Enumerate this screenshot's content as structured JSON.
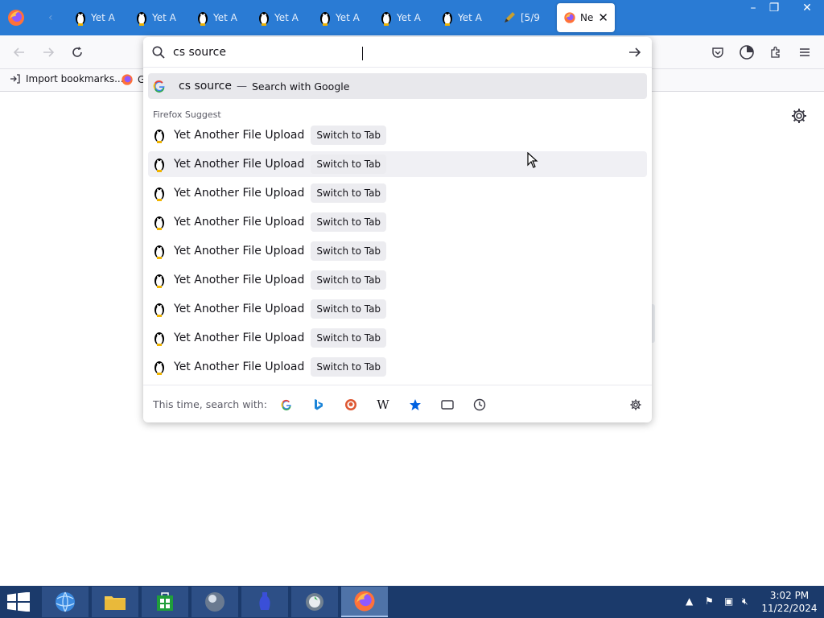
{
  "tabs": [
    {
      "label": "Yet A",
      "icon": "penguin-icon"
    },
    {
      "label": "Yet A",
      "icon": "penguin-icon"
    },
    {
      "label": "Yet A",
      "icon": "penguin-icon"
    },
    {
      "label": "Yet A",
      "icon": "penguin-icon"
    },
    {
      "label": "Yet A",
      "icon": "penguin-icon"
    },
    {
      "label": "Yet A",
      "icon": "penguin-icon"
    },
    {
      "label": "Yet A",
      "icon": "penguin-icon"
    },
    {
      "label": "[5/9",
      "icon": "pencil-icon"
    },
    {
      "label": "Ne",
      "icon": "firefox-icon"
    }
  ],
  "bookmarks": {
    "import_label": "Import bookmarks...",
    "getting_started_label": "G"
  },
  "urlbar": {
    "value": "cs source",
    "google_suggestion": {
      "query": "cs source",
      "separator": "—",
      "action": "Search with Google"
    },
    "section_label": "Firefox Suggest",
    "rows": [
      {
        "title": "Yet Another File Upload",
        "action": "Switch to Tab"
      },
      {
        "title": "Yet Another File Upload",
        "action": "Switch to Tab"
      },
      {
        "title": "Yet Another File Upload",
        "action": "Switch to Tab"
      },
      {
        "title": "Yet Another File Upload",
        "action": "Switch to Tab"
      },
      {
        "title": "Yet Another File Upload",
        "action": "Switch to Tab"
      },
      {
        "title": "Yet Another File Upload",
        "action": "Switch to Tab"
      },
      {
        "title": "Yet Another File Upload",
        "action": "Switch to Tab"
      },
      {
        "title": "Yet Another File Upload",
        "action": "Switch to Tab"
      },
      {
        "title": "Yet Another File Upload",
        "action": "Switch to Tab"
      }
    ],
    "search_with_label": "This time, search with:",
    "wikipedia_glyph": "W"
  },
  "taskbar": {
    "time": "3:02 PM",
    "date": "11/22/2024"
  },
  "colors": {
    "tabstrip": "#2a7bd4",
    "taskbar": "#1b3a6b",
    "accent": "#0061e0"
  }
}
